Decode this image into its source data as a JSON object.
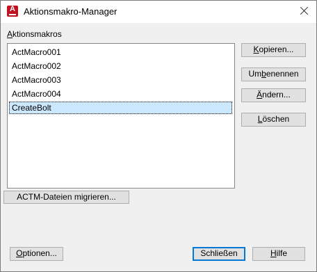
{
  "window": {
    "title": "Aktionsmakro-Manager"
  },
  "section": {
    "label_u": "A",
    "label_rest": "ktionsmakros"
  },
  "list": {
    "items": [
      "ActMacro001",
      "ActMacro002",
      "ActMacro003",
      "ActMacro004",
      "CreateBolt"
    ],
    "selected": "CreateBolt"
  },
  "buttons": {
    "kopieren": {
      "u": "K",
      "rest": "opieren..."
    },
    "umbenennen": {
      "pre": "Um",
      "u": "b",
      "rest": "enennen"
    },
    "aendern": {
      "u": "Ä",
      "rest": "ndern..."
    },
    "loeschen": {
      "u": "L",
      "rest": "öschen"
    },
    "migrate": {
      "label": "ACTM-Dateien migrieren..."
    },
    "optionen": {
      "u": "O",
      "rest": "ptionen..."
    },
    "schliessen": {
      "label": "Schließen"
    },
    "hilfe": {
      "u": "H",
      "rest": "ilfe"
    }
  },
  "colors": {
    "selection": "#cce8ff",
    "default_border": "#0078d7",
    "app_icon": "#c1121f"
  },
  "icons": {
    "app": "autocad-a-icon",
    "close": "close-icon"
  }
}
